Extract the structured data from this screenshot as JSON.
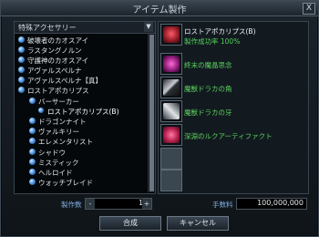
{
  "window": {
    "title": "アイテム製作",
    "close_label": "X"
  },
  "category": {
    "selected": "特殊アクセサリー",
    "arrow": "▼"
  },
  "tree": [
    {
      "label": "破壊者のカオスアイ",
      "level": 0
    },
    {
      "label": "ラスタングノルン",
      "level": 0
    },
    {
      "label": "守護神のカオスアイ",
      "level": 0
    },
    {
      "label": "アヴァルスペルナ",
      "level": 0
    },
    {
      "label": "アヴァルスペルナ【真】",
      "level": 0
    },
    {
      "label": "ロストアポカリプス",
      "level": 0
    },
    {
      "label": "バーサーカー",
      "level": 1
    },
    {
      "label": "ロストアポカリプス(B)",
      "level": 2,
      "selected": true
    },
    {
      "label": "ドラゴンナイト",
      "level": 1
    },
    {
      "label": "ヴァルキリー",
      "level": 1
    },
    {
      "label": "エレメンタリスト",
      "level": 1
    },
    {
      "label": "シャドウ",
      "level": 1
    },
    {
      "label": "ミスティック",
      "level": 1
    },
    {
      "label": "ヘルロイド",
      "level": 1
    },
    {
      "label": "ウォッチブレイド",
      "level": 1
    }
  ],
  "recipe": {
    "name": "ロストアポカリプス(B)",
    "rate_text": "製作成功率 100%",
    "materials": [
      "終末の魔晶思念",
      "魔獣ドラカの角",
      "魔獣ドラカの牙",
      "深淵のルクアーティファクト"
    ]
  },
  "bottom": {
    "qty_label": "製作数",
    "qty_value": "1",
    "minus": "-",
    "plus": "+",
    "fee_label": "手数料",
    "fee_value": "100,000,000"
  },
  "buttons": {
    "combine": "合成",
    "cancel": "キャンセル"
  }
}
